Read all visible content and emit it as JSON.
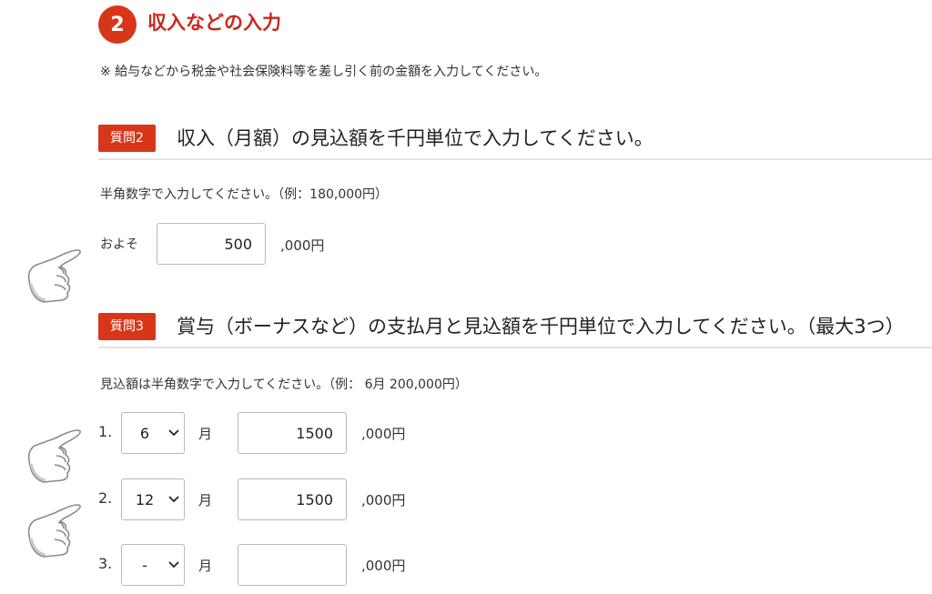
{
  "section": {
    "step_number": "2",
    "title": "収入などの入力",
    "note": "※ 給与などから税金や社会保険料等を差し引く前の金額を入力してください。"
  },
  "question2": {
    "badge": "質問2",
    "text": "収入（月額）の見込額を千円単位で入力してください。",
    "hint": "半角数字で入力してください。（例：180,000円）",
    "prefix": "およそ",
    "value": "500",
    "unit": ",000円"
  },
  "question3": {
    "badge": "質問3",
    "text": "賞与（ボーナスなど）の支払月と見込額を千円単位で入力してください。（最大3つ）",
    "hint": "見込額は半角数字で入力してください。（例： 6月 200,000円）",
    "month_label": "月",
    "unit": ",000円",
    "rows": [
      {
        "index": "1.",
        "month": "6",
        "amount": "1500"
      },
      {
        "index": "2.",
        "month": "12",
        "amount": "1500"
      },
      {
        "index": "3.",
        "month": "-",
        "amount": ""
      }
    ]
  },
  "icons": {
    "pointer": "pointing-hand-icon",
    "chevron": "chevron-down-icon",
    "accent_color": "#d8361a"
  }
}
